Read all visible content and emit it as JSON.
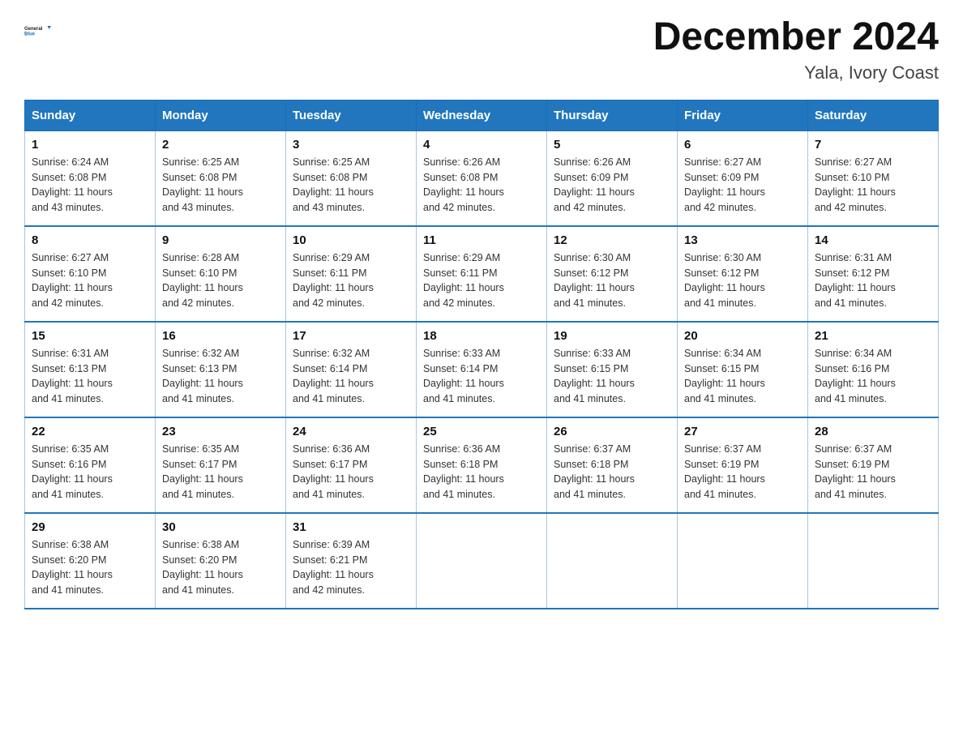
{
  "header": {
    "logo_text_general": "General",
    "logo_text_blue": "Blue",
    "month_title": "December 2024",
    "location": "Yala, Ivory Coast"
  },
  "days_of_week": [
    "Sunday",
    "Monday",
    "Tuesday",
    "Wednesday",
    "Thursday",
    "Friday",
    "Saturday"
  ],
  "weeks": [
    [
      {
        "day": "1",
        "sunrise": "6:24 AM",
        "sunset": "6:08 PM",
        "daylight": "11 hours and 43 minutes."
      },
      {
        "day": "2",
        "sunrise": "6:25 AM",
        "sunset": "6:08 PM",
        "daylight": "11 hours and 43 minutes."
      },
      {
        "day": "3",
        "sunrise": "6:25 AM",
        "sunset": "6:08 PM",
        "daylight": "11 hours and 43 minutes."
      },
      {
        "day": "4",
        "sunrise": "6:26 AM",
        "sunset": "6:08 PM",
        "daylight": "11 hours and 42 minutes."
      },
      {
        "day": "5",
        "sunrise": "6:26 AM",
        "sunset": "6:09 PM",
        "daylight": "11 hours and 42 minutes."
      },
      {
        "day": "6",
        "sunrise": "6:27 AM",
        "sunset": "6:09 PM",
        "daylight": "11 hours and 42 minutes."
      },
      {
        "day": "7",
        "sunrise": "6:27 AM",
        "sunset": "6:10 PM",
        "daylight": "11 hours and 42 minutes."
      }
    ],
    [
      {
        "day": "8",
        "sunrise": "6:27 AM",
        "sunset": "6:10 PM",
        "daylight": "11 hours and 42 minutes."
      },
      {
        "day": "9",
        "sunrise": "6:28 AM",
        "sunset": "6:10 PM",
        "daylight": "11 hours and 42 minutes."
      },
      {
        "day": "10",
        "sunrise": "6:29 AM",
        "sunset": "6:11 PM",
        "daylight": "11 hours and 42 minutes."
      },
      {
        "day": "11",
        "sunrise": "6:29 AM",
        "sunset": "6:11 PM",
        "daylight": "11 hours and 42 minutes."
      },
      {
        "day": "12",
        "sunrise": "6:30 AM",
        "sunset": "6:12 PM",
        "daylight": "11 hours and 41 minutes."
      },
      {
        "day": "13",
        "sunrise": "6:30 AM",
        "sunset": "6:12 PM",
        "daylight": "11 hours and 41 minutes."
      },
      {
        "day": "14",
        "sunrise": "6:31 AM",
        "sunset": "6:12 PM",
        "daylight": "11 hours and 41 minutes."
      }
    ],
    [
      {
        "day": "15",
        "sunrise": "6:31 AM",
        "sunset": "6:13 PM",
        "daylight": "11 hours and 41 minutes."
      },
      {
        "day": "16",
        "sunrise": "6:32 AM",
        "sunset": "6:13 PM",
        "daylight": "11 hours and 41 minutes."
      },
      {
        "day": "17",
        "sunrise": "6:32 AM",
        "sunset": "6:14 PM",
        "daylight": "11 hours and 41 minutes."
      },
      {
        "day": "18",
        "sunrise": "6:33 AM",
        "sunset": "6:14 PM",
        "daylight": "11 hours and 41 minutes."
      },
      {
        "day": "19",
        "sunrise": "6:33 AM",
        "sunset": "6:15 PM",
        "daylight": "11 hours and 41 minutes."
      },
      {
        "day": "20",
        "sunrise": "6:34 AM",
        "sunset": "6:15 PM",
        "daylight": "11 hours and 41 minutes."
      },
      {
        "day": "21",
        "sunrise": "6:34 AM",
        "sunset": "6:16 PM",
        "daylight": "11 hours and 41 minutes."
      }
    ],
    [
      {
        "day": "22",
        "sunrise": "6:35 AM",
        "sunset": "6:16 PM",
        "daylight": "11 hours and 41 minutes."
      },
      {
        "day": "23",
        "sunrise": "6:35 AM",
        "sunset": "6:17 PM",
        "daylight": "11 hours and 41 minutes."
      },
      {
        "day": "24",
        "sunrise": "6:36 AM",
        "sunset": "6:17 PM",
        "daylight": "11 hours and 41 minutes."
      },
      {
        "day": "25",
        "sunrise": "6:36 AM",
        "sunset": "6:18 PM",
        "daylight": "11 hours and 41 minutes."
      },
      {
        "day": "26",
        "sunrise": "6:37 AM",
        "sunset": "6:18 PM",
        "daylight": "11 hours and 41 minutes."
      },
      {
        "day": "27",
        "sunrise": "6:37 AM",
        "sunset": "6:19 PM",
        "daylight": "11 hours and 41 minutes."
      },
      {
        "day": "28",
        "sunrise": "6:37 AM",
        "sunset": "6:19 PM",
        "daylight": "11 hours and 41 minutes."
      }
    ],
    [
      {
        "day": "29",
        "sunrise": "6:38 AM",
        "sunset": "6:20 PM",
        "daylight": "11 hours and 41 minutes."
      },
      {
        "day": "30",
        "sunrise": "6:38 AM",
        "sunset": "6:20 PM",
        "daylight": "11 hours and 41 minutes."
      },
      {
        "day": "31",
        "sunrise": "6:39 AM",
        "sunset": "6:21 PM",
        "daylight": "11 hours and 42 minutes."
      },
      null,
      null,
      null,
      null
    ]
  ],
  "labels": {
    "sunrise": "Sunrise:",
    "sunset": "Sunset:",
    "daylight": "Daylight:"
  }
}
